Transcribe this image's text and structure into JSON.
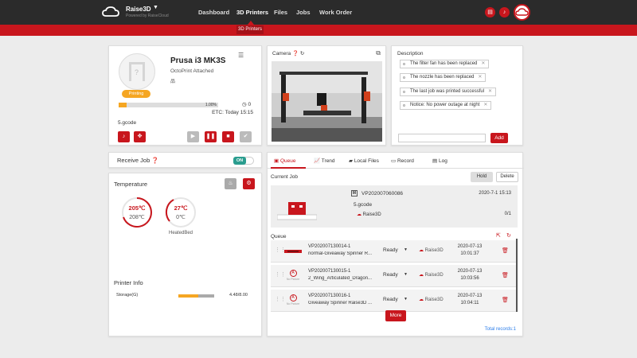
{
  "header": {
    "brand": "Raise3D",
    "brand_sub": "Powered by RaiseCloud",
    "nav": [
      "Dashboard",
      "3D Printers",
      "Files",
      "Jobs",
      "Work Order"
    ],
    "active_nav": "3D Printers",
    "sub_tab": "3D Printers",
    "icons": [
      "document-icon",
      "bell-icon",
      "cloud-avatar-icon"
    ]
  },
  "printer": {
    "name": "Prusa i3 MK3S",
    "attachment": "OctoPrint Attached",
    "status": "Printing",
    "progress_label": "1.00%",
    "progress": 0.01,
    "timer": "0",
    "etc": "ETC: Today 15:15",
    "file": "5.gcode"
  },
  "camera": {
    "title": "Camera"
  },
  "description": {
    "title": "Description",
    "tags": [
      "The filter fan has been replaced",
      "The nozzle has been replaced",
      "The last job was printed successful",
      "Notice: No power outage at night"
    ],
    "add_label": "Add"
  },
  "receive_job": {
    "label": "Receive Job",
    "toggle": "ON"
  },
  "temperature": {
    "title": "Temperature",
    "nozzle_current": "205℃",
    "nozzle_target": "208℃",
    "bed_current": "27℃",
    "bed_target": "0℃",
    "bed_label": "HeatedBed"
  },
  "printer_info": {
    "title": "Printer Info",
    "storage_label": "Storage(G)",
    "storage_value": "4.48/8.00",
    "storage_fraction": 0.56
  },
  "tabs": [
    "Queue",
    "Trend",
    "Local Files",
    "Record",
    "Log"
  ],
  "current_job": {
    "label": "Current Job",
    "hold": "Hold",
    "delete": "Delete",
    "badge": "M",
    "id": "VP202007060086",
    "date": "2020-7-1 15:13",
    "file": "5.gcode",
    "owner": "Raise3D",
    "count": "0/1"
  },
  "queue": {
    "label": "Queue",
    "rows": [
      {
        "id": "VP202007130014-1",
        "name": "normal-Giveaway Spinner R...",
        "status": "Ready",
        "owner": "Raise3D",
        "date": "2020-07-13",
        "time": "10:01:37"
      },
      {
        "id": "VP202007130015-1",
        "name": "2_Wing_Articulated_Dragon...",
        "status": "Ready",
        "owner": "Raise3D",
        "date": "2020-07-13",
        "time": "10:03:56"
      },
      {
        "id": "VP202007130016-1",
        "name": "Giveaway Spinner Raise3D ...",
        "status": "Ready",
        "owner": "Raise3D",
        "date": "2020-07-13",
        "time": "10:04:11"
      }
    ],
    "no_picture": "No Picture",
    "more": "More",
    "total": "Total records:1"
  },
  "colors": {
    "accent": "#c8161d",
    "header": "#2b2b2b",
    "status": "#f5a623",
    "toggle": "#2a9d8f"
  }
}
